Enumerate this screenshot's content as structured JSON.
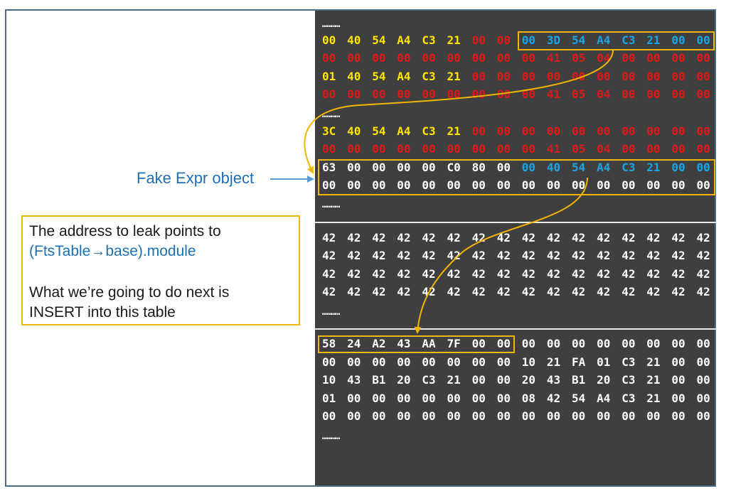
{
  "colors": {
    "white": "#ffffff",
    "yellow": "#ffe600",
    "red": "#e01818",
    "cyan": "#19a5e6",
    "highlight": "#f2b600",
    "label_blue": "#1f6fb3",
    "panel_bg": "#3f3f3f"
  },
  "ellipsis": "…………",
  "label": "Fake Expr object",
  "note": {
    "line1": "The address to leak points to",
    "line2": "(FtsTable→base).module",
    "line3": "What we’re going to do next is",
    "line4": "INSERT into this table"
  },
  "rows": [
    {
      "bytes": [
        "00",
        "40",
        "54",
        "A4",
        "C3",
        "21",
        "00",
        "00",
        "00",
        "3D",
        "54",
        "A4",
        "C3",
        "21",
        "00",
        "00"
      ],
      "colors": [
        "y",
        "y",
        "y",
        "y",
        "y",
        "y",
        "r",
        "r",
        "c",
        "c",
        "c",
        "c",
        "c",
        "c",
        "c",
        "c"
      ]
    },
    {
      "bytes": [
        "00",
        "00",
        "00",
        "00",
        "00",
        "00",
        "00",
        "00",
        "00",
        "41",
        "05",
        "04",
        "00",
        "00",
        "00",
        "00"
      ],
      "colors": [
        "r",
        "r",
        "r",
        "r",
        "r",
        "r",
        "r",
        "r",
        "r",
        "r",
        "r",
        "r",
        "r",
        "r",
        "r",
        "r"
      ]
    },
    {
      "bytes": [
        "01",
        "40",
        "54",
        "A4",
        "C3",
        "21",
        "00",
        "00",
        "00",
        "00",
        "00",
        "00",
        "00",
        "00",
        "00",
        "00"
      ],
      "colors": [
        "y",
        "y",
        "y",
        "y",
        "y",
        "y",
        "r",
        "r",
        "r",
        "r",
        "r",
        "r",
        "r",
        "r",
        "r",
        "r"
      ]
    },
    {
      "bytes": [
        "00",
        "00",
        "00",
        "00",
        "00",
        "00",
        "00",
        "00",
        "00",
        "41",
        "05",
        "04",
        "00",
        "00",
        "00",
        "00"
      ],
      "colors": [
        "r",
        "r",
        "r",
        "r",
        "r",
        "r",
        "r",
        "r",
        "r",
        "r",
        "r",
        "r",
        "r",
        "r",
        "r",
        "r"
      ]
    },
    {
      "bytes": [
        "3C",
        "40",
        "54",
        "A4",
        "C3",
        "21",
        "00",
        "00",
        "00",
        "00",
        "00",
        "00",
        "00",
        "00",
        "00",
        "00"
      ],
      "colors": [
        "y",
        "y",
        "y",
        "y",
        "y",
        "y",
        "r",
        "r",
        "r",
        "r",
        "r",
        "r",
        "r",
        "r",
        "r",
        "r"
      ]
    },
    {
      "bytes": [
        "00",
        "00",
        "00",
        "00",
        "00",
        "00",
        "00",
        "00",
        "00",
        "41",
        "05",
        "04",
        "00",
        "00",
        "00",
        "00"
      ],
      "colors": [
        "r",
        "r",
        "r",
        "r",
        "r",
        "r",
        "r",
        "r",
        "r",
        "r",
        "r",
        "r",
        "r",
        "r",
        "r",
        "r"
      ]
    },
    {
      "bytes": [
        "63",
        "00",
        "00",
        "00",
        "00",
        "C0",
        "80",
        "00",
        "00",
        "40",
        "54",
        "A4",
        "C3",
        "21",
        "00",
        "00"
      ],
      "colors": [
        "w",
        "w",
        "w",
        "w",
        "w",
        "w",
        "w",
        "w",
        "c",
        "c",
        "c",
        "c",
        "c",
        "c",
        "c",
        "c"
      ]
    },
    {
      "bytes": [
        "00",
        "00",
        "00",
        "00",
        "00",
        "00",
        "00",
        "00",
        "00",
        "00",
        "00",
        "00",
        "00",
        "00",
        "00",
        "00"
      ],
      "colors": [
        "w",
        "w",
        "w",
        "w",
        "w",
        "w",
        "w",
        "w",
        "w",
        "w",
        "w",
        "w",
        "w",
        "w",
        "w",
        "w"
      ]
    },
    {
      "bytes": [
        "42",
        "42",
        "42",
        "42",
        "42",
        "42",
        "42",
        "42",
        "42",
        "42",
        "42",
        "42",
        "42",
        "42",
        "42",
        "42"
      ],
      "colors": [
        "w",
        "w",
        "w",
        "w",
        "w",
        "w",
        "w",
        "w",
        "w",
        "w",
        "w",
        "w",
        "w",
        "w",
        "w",
        "w"
      ]
    },
    {
      "bytes": [
        "42",
        "42",
        "42",
        "42",
        "42",
        "42",
        "42",
        "42",
        "42",
        "42",
        "42",
        "42",
        "42",
        "42",
        "42",
        "42"
      ],
      "colors": [
        "w",
        "w",
        "w",
        "w",
        "w",
        "w",
        "w",
        "w",
        "w",
        "w",
        "w",
        "w",
        "w",
        "w",
        "w",
        "w"
      ]
    },
    {
      "bytes": [
        "42",
        "42",
        "42",
        "42",
        "42",
        "42",
        "42",
        "42",
        "42",
        "42",
        "42",
        "42",
        "42",
        "42",
        "42",
        "42"
      ],
      "colors": [
        "w",
        "w",
        "w",
        "w",
        "w",
        "w",
        "w",
        "w",
        "w",
        "w",
        "w",
        "w",
        "w",
        "w",
        "w",
        "w"
      ]
    },
    {
      "bytes": [
        "42",
        "42",
        "42",
        "42",
        "42",
        "42",
        "42",
        "42",
        "42",
        "42",
        "42",
        "42",
        "42",
        "42",
        "42",
        "42"
      ],
      "colors": [
        "w",
        "w",
        "w",
        "w",
        "w",
        "w",
        "w",
        "w",
        "w",
        "w",
        "w",
        "w",
        "w",
        "w",
        "w",
        "w"
      ]
    },
    {
      "bytes": [
        "58",
        "24",
        "A2",
        "43",
        "AA",
        "7F",
        "00",
        "00",
        "00",
        "00",
        "00",
        "00",
        "00",
        "00",
        "00",
        "00"
      ],
      "colors": [
        "w",
        "w",
        "w",
        "w",
        "w",
        "w",
        "w",
        "w",
        "w",
        "w",
        "w",
        "w",
        "w",
        "w",
        "w",
        "w"
      ]
    },
    {
      "bytes": [
        "00",
        "00",
        "00",
        "00",
        "00",
        "00",
        "00",
        "00",
        "10",
        "21",
        "FA",
        "01",
        "C3",
        "21",
        "00",
        "00"
      ],
      "colors": [
        "w",
        "w",
        "w",
        "w",
        "w",
        "w",
        "w",
        "w",
        "w",
        "w",
        "w",
        "w",
        "w",
        "w",
        "w",
        "w"
      ]
    },
    {
      "bytes": [
        "10",
        "43",
        "B1",
        "20",
        "C3",
        "21",
        "00",
        "00",
        "20",
        "43",
        "B1",
        "20",
        "C3",
        "21",
        "00",
        "00"
      ],
      "colors": [
        "w",
        "w",
        "w",
        "w",
        "w",
        "w",
        "w",
        "w",
        "w",
        "w",
        "w",
        "w",
        "w",
        "w",
        "w",
        "w"
      ]
    },
    {
      "bytes": [
        "01",
        "00",
        "00",
        "00",
        "00",
        "00",
        "00",
        "00",
        "08",
        "42",
        "54",
        "A4",
        "C3",
        "21",
        "00",
        "00"
      ],
      "colors": [
        "w",
        "w",
        "w",
        "w",
        "w",
        "w",
        "w",
        "w",
        "w",
        "w",
        "w",
        "w",
        "w",
        "w",
        "w",
        "w"
      ]
    },
    {
      "bytes": [
        "00",
        "00",
        "00",
        "00",
        "00",
        "00",
        "00",
        "00",
        "00",
        "00",
        "00",
        "00",
        "00",
        "00",
        "00",
        "00"
      ],
      "colors": [
        "w",
        "w",
        "w",
        "w",
        "w",
        "w",
        "w",
        "w",
        "w",
        "w",
        "w",
        "w",
        "w",
        "w",
        "w",
        "w"
      ]
    }
  ]
}
